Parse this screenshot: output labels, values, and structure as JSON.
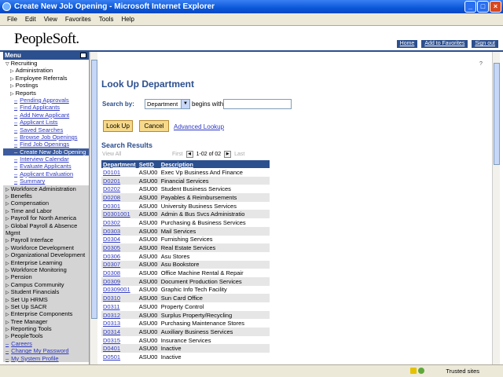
{
  "window": {
    "title": "Create New Job Opening - Microsoft Internet Explorer"
  },
  "menubar": [
    "File",
    "Edit",
    "View",
    "Favorites",
    "Tools",
    "Help"
  ],
  "header": {
    "logo": "PeopleSoft.",
    "links": [
      "Home",
      "Add to Favorites",
      "Sign out"
    ]
  },
  "sidebar": {
    "title": "Menu",
    "items": [
      {
        "label": "Recruiting",
        "level": 1,
        "state": "open"
      },
      {
        "label": "Administration",
        "level": 2
      },
      {
        "label": "Employee Referrals",
        "level": 2
      },
      {
        "label": "Postings",
        "level": 2
      },
      {
        "label": "Reports",
        "level": 2
      },
      {
        "label": "Pending Approvals",
        "level": 3
      },
      {
        "label": "Find Applicants",
        "level": 3
      },
      {
        "label": "Add New Applicant",
        "level": 3
      },
      {
        "label": "Applicant Lists",
        "level": 3
      },
      {
        "label": "Saved Searches",
        "level": 3
      },
      {
        "label": "Browse Job Openings",
        "level": 3
      },
      {
        "label": "Find Job Openings",
        "level": 3
      },
      {
        "label": "Create New Job Opening",
        "level": 3,
        "selected": true
      },
      {
        "label": "Interview Calendar",
        "level": 3
      },
      {
        "label": "Evaluate Applicants",
        "level": 3
      },
      {
        "label": "Applicant Evaluation",
        "level": 3
      },
      {
        "label": "Summary",
        "level": 3
      },
      {
        "label": "Workforce Administration",
        "level": 1
      },
      {
        "label": "Benefits",
        "level": 1
      },
      {
        "label": "Compensation",
        "level": 1
      },
      {
        "label": "Time and Labor",
        "level": 1
      },
      {
        "label": "Payroll for North America",
        "level": 1
      },
      {
        "label": "Global Payroll & Absence",
        "level": 1
      },
      {
        "label": "Mgmt",
        "level": 1
      },
      {
        "label": "Payroll Interface",
        "level": 1
      },
      {
        "label": "Workforce Development",
        "level": 1
      },
      {
        "label": "Organizational Development",
        "level": 1
      },
      {
        "label": "Enterprise Learning",
        "level": 1
      },
      {
        "label": "Workforce Monitoring",
        "level": 1
      },
      {
        "label": "Pension",
        "level": 1
      },
      {
        "label": "Campus Community",
        "level": 1
      },
      {
        "label": "Student Financials",
        "level": 1
      },
      {
        "label": "Set Up HRMS",
        "level": 1
      },
      {
        "label": "Set Up SACR",
        "level": 1
      },
      {
        "label": "Enterprise Components",
        "level": 1
      },
      {
        "label": "Tree Manager",
        "level": 1
      },
      {
        "label": "Reporting Tools",
        "level": 1
      },
      {
        "label": "PeopleTools",
        "level": 1
      },
      {
        "label": "Careers",
        "level": 0
      },
      {
        "label": "Change My Password",
        "level": 0
      },
      {
        "label": "My System Profile",
        "level": 0
      }
    ]
  },
  "main": {
    "title": "Look Up Department",
    "search_by_label": "Search by:",
    "search_by_value": "Department",
    "begins_with_label": "begins with",
    "lookup_button": "Look Up",
    "cancel_button": "Cancel",
    "advanced_link": "Advanced Lookup",
    "results_title": "Search Results",
    "view_all": "View All",
    "pager_first": "First",
    "pager_range": "1-02 of 02",
    "pager_last": "Last",
    "columns": [
      "Department",
      "SetID",
      "Description"
    ],
    "rows": [
      [
        "D0101",
        "ASU00",
        "Exec Vp Business And Finance"
      ],
      [
        "D0201",
        "ASU00",
        "Financial Services"
      ],
      [
        "D0202",
        "ASU00",
        "Student Business Services"
      ],
      [
        "D0208",
        "ASU00",
        "Payables & Reimbursements"
      ],
      [
        "D0301",
        "ASU00",
        "University Business Services"
      ],
      [
        "D0301001",
        "ASU00",
        "Admin & Bus Svcs Administratio"
      ],
      [
        "D0302",
        "ASU00",
        "Purchasing & Business Services"
      ],
      [
        "D0303",
        "ASU00",
        "Mail Services"
      ],
      [
        "D0304",
        "ASU00",
        "Furnishing Services"
      ],
      [
        "D0305",
        "ASU00",
        "Real Estate Services"
      ],
      [
        "D0306",
        "ASU00",
        "Asu Stores"
      ],
      [
        "D0307",
        "ASU00",
        "Asu Bookstore"
      ],
      [
        "D0308",
        "ASU00",
        "Office Machine Rental & Repair"
      ],
      [
        "D0309",
        "ASU00",
        "Document Production Services"
      ],
      [
        "D0309001",
        "ASU00",
        "Graphic Info Tech Facility"
      ],
      [
        "D0310",
        "ASU00",
        "Sun Card Office"
      ],
      [
        "D0311",
        "ASU00",
        "Property Control"
      ],
      [
        "D0312",
        "ASU00",
        "Surplus Property/Recycling"
      ],
      [
        "D0313",
        "ASU00",
        "Purchasing Maintenance Stores"
      ],
      [
        "D0314",
        "ASU00",
        "Auxiliary Business Services"
      ],
      [
        "D0315",
        "ASU00",
        "Insurance Services"
      ],
      [
        "D0401",
        "ASU00",
        "Inactive"
      ],
      [
        "D0501",
        "ASU00",
        "Inactive"
      ]
    ]
  },
  "statusbar": {
    "left": "",
    "zone": "Trusted sites"
  }
}
